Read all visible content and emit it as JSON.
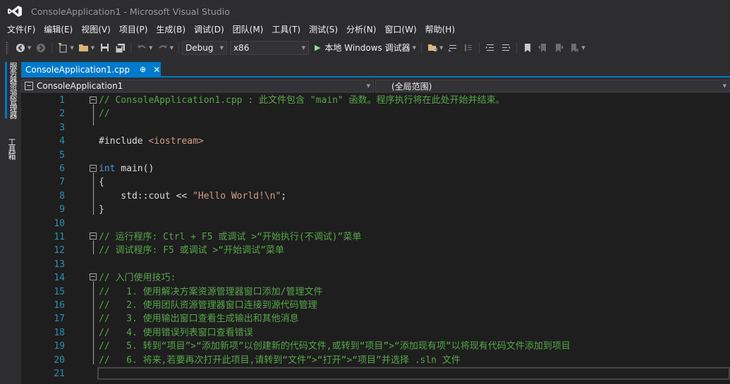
{
  "window": {
    "title": "ConsoleApplication1 - Microsoft Visual Studio"
  },
  "menu": [
    "文件(F)",
    "编辑(E)",
    "视图(V)",
    "项目(P)",
    "生成(B)",
    "调试(D)",
    "团队(M)",
    "工具(T)",
    "测试(S)",
    "分析(N)",
    "窗口(W)",
    "帮助(H)"
  ],
  "toolbar": {
    "configuration": "Debug",
    "platform": "x86",
    "run_label": "本地 Windows 调试器"
  },
  "sidebar": {
    "tabs": [
      "服务器资源管理器",
      "工具箱"
    ]
  },
  "document": {
    "tab_label": "ConsoleApplication1.cpp",
    "pin_glyph": "⊕",
    "close_glyph": "✕"
  },
  "navbar": {
    "scope_left": "ConsoleApplication1",
    "scope_right": "(全局范围)"
  },
  "editor": {
    "lines": [
      {
        "n": "1",
        "segments": [
          {
            "t": "// ConsoleApplication1.cpp : 此文件包含 \"main\" 函数。程序执行将在此处开始并结束。",
            "c": "cm"
          }
        ]
      },
      {
        "n": "2",
        "segments": [
          {
            "t": "//",
            "c": "cm"
          }
        ]
      },
      {
        "n": "3",
        "segments": []
      },
      {
        "n": "4",
        "segments": [
          {
            "t": "#include ",
            "c": "plain"
          },
          {
            "t": "<iostream>",
            "c": "str"
          }
        ]
      },
      {
        "n": "5",
        "segments": []
      },
      {
        "n": "6",
        "segments": [
          {
            "t": "int",
            "c": "kw"
          },
          {
            "t": " main()",
            "c": "plain"
          }
        ]
      },
      {
        "n": "7",
        "segments": [
          {
            "t": "{",
            "c": "plain"
          }
        ]
      },
      {
        "n": "8",
        "segments": [
          {
            "t": "    std::cout << ",
            "c": "plain"
          },
          {
            "t": "\"Hello World!\\n\"",
            "c": "str"
          },
          {
            "t": ";",
            "c": "plain"
          }
        ]
      },
      {
        "n": "9",
        "segments": [
          {
            "t": "}",
            "c": "plain"
          }
        ]
      },
      {
        "n": "10",
        "segments": []
      },
      {
        "n": "11",
        "segments": [
          {
            "t": "// 运行程序: Ctrl + F5 或调试 >“开始执行(不调试)”菜单",
            "c": "cm"
          }
        ]
      },
      {
        "n": "12",
        "segments": [
          {
            "t": "// 调试程序: F5 或调试 >“开始调试”菜单",
            "c": "cm"
          }
        ]
      },
      {
        "n": "13",
        "segments": []
      },
      {
        "n": "14",
        "segments": [
          {
            "t": "// 入门使用技巧:",
            "c": "cm"
          }
        ]
      },
      {
        "n": "15",
        "segments": [
          {
            "t": "//   1. 使用解决方案资源管理器窗口添加/管理文件",
            "c": "cm"
          }
        ]
      },
      {
        "n": "16",
        "segments": [
          {
            "t": "//   2. 使用团队资源管理器窗口连接到源代码管理",
            "c": "cm"
          }
        ]
      },
      {
        "n": "17",
        "segments": [
          {
            "t": "//   3. 使用输出窗口查看生成输出和其他消息",
            "c": "cm"
          }
        ]
      },
      {
        "n": "18",
        "segments": [
          {
            "t": "//   4. 使用错误列表窗口查看错误",
            "c": "cm"
          }
        ]
      },
      {
        "n": "19",
        "segments": [
          {
            "t": "//   5. 转到“项目”>“添加新项”以创建新的代码文件,或转到“项目”>“添加现有项”以将现有代码文件添加到项目",
            "c": "cm"
          }
        ]
      },
      {
        "n": "20",
        "segments": [
          {
            "t": "//   6. 将来,若要再次打开此项目,请转到“文件”>“打开”>“项目”并选择 .sln 文件",
            "c": "cm"
          }
        ]
      },
      {
        "n": "21",
        "segments": []
      }
    ]
  },
  "colors": {
    "accent": "#007acc",
    "comment": "#57a64a",
    "keyword": "#569cd6",
    "string": "#d69d85",
    "line_number": "#2b91af"
  }
}
